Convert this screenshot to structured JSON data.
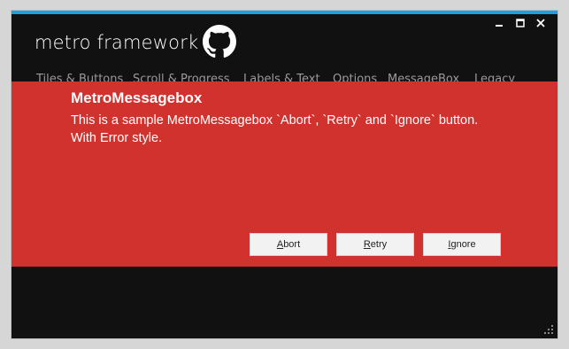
{
  "window": {
    "title": "metro framework",
    "accent_color": "#1ba1e2",
    "controls": {
      "minimize_icon": "minimize-icon",
      "maximize_icon": "maximize-icon",
      "close_icon": "close-icon"
    }
  },
  "tabs": [
    {
      "label": "Tiles & Buttons"
    },
    {
      "label": "Scroll & Progress"
    },
    {
      "label": "Labels & Text"
    },
    {
      "label": "Options"
    },
    {
      "label": "MessageBox"
    },
    {
      "label": "Legacy"
    }
  ],
  "messagebox": {
    "style_color": "#d2322d",
    "title": "MetroMessagebox",
    "line1": "This is a sample MetroMessagebox `Abort`, `Retry` and `Ignore` button.",
    "line2": "With Error style.",
    "buttons": {
      "abort": {
        "mnemonic": "A",
        "rest": "bort"
      },
      "retry": {
        "mnemonic": "R",
        "rest": "etry"
      },
      "ignore": {
        "mnemonic": "I",
        "rest": "gnore"
      }
    }
  }
}
